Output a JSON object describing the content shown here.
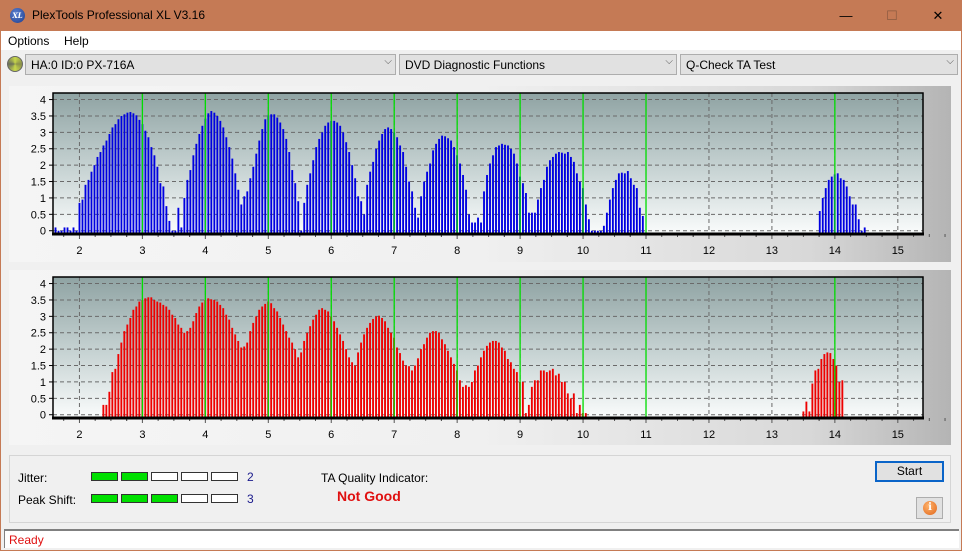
{
  "window": {
    "title": "PlexTools Professional XL V3.16",
    "app_icon_text": "XL",
    "controls": {
      "minimize": "—",
      "maximize": "☐",
      "close": "✕"
    }
  },
  "menu": {
    "items": [
      {
        "label": "Options"
      },
      {
        "label": "Help"
      }
    ]
  },
  "toolbar": {
    "drive": {
      "value": "HA:0 ID:0  PX-716A",
      "icon": "disc-drive-icon"
    },
    "function": {
      "value": "DVD Diagnostic Functions"
    },
    "test": {
      "value": "Q-Check TA Test"
    },
    "arrow": "⌵"
  },
  "colors": {
    "top_bars": "#0000e0",
    "bottom_bars": "#ee0000",
    "marker_lines": "#00dd00",
    "quality_text": "#e01010",
    "meter_on": "#00e000"
  },
  "chart_data": [
    {
      "type": "bar",
      "title": "",
      "name": "TA distribution (upper)",
      "xlabel": "",
      "ylabel": "",
      "xlim": [
        1.58,
        15.4
      ],
      "ylim": [
        -0.1,
        4.2
      ],
      "xticks": [
        2,
        3,
        4,
        5,
        6,
        7,
        8,
        9,
        10,
        11,
        12,
        13,
        14,
        15
      ],
      "yticks": [
        "0",
        "0.5",
        "1",
        "1.5",
        "2",
        "2.5",
        "3",
        "3.5",
        "4"
      ],
      "grid": true,
      "marker_lines": [
        3,
        4,
        5,
        6,
        7,
        8,
        9,
        10,
        11,
        14
      ],
      "bar_step": 0.0476,
      "segments": [
        {
          "start": 1.62,
          "values": [
            0.1,
            0,
            0,
            0.1,
            0.1,
            0,
            0.1,
            0,
            0.85,
            0.95,
            1.4,
            1.55,
            1.8,
            2.0,
            2.25,
            2.4,
            2.6,
            2.75,
            2.95,
            3.15,
            3.25,
            3.4,
            3.5,
            3.55,
            3.6,
            3.62,
            3.58,
            3.52,
            3.38,
            3.25,
            3.05,
            2.85,
            2.55,
            2.3,
            1.95,
            1.45,
            1.35,
            0.75,
            0.3,
            0,
            0,
            0.7,
            0.1,
            1.0,
            1.55,
            1.85,
            2.3,
            2.65,
            2.95,
            3.2,
            3.42,
            3.58,
            3.65,
            3.6,
            3.5,
            3.35,
            3.15,
            2.85,
            2.55,
            2.2,
            1.75,
            1.25,
            0.8,
            1.05,
            1.2,
            1.6,
            1.95,
            2.35,
            2.75,
            3.1,
            3.4,
            3.52,
            3.55,
            3.55,
            3.45,
            3.3,
            3.1,
            2.8,
            2.4,
            1.85,
            1.45,
            0.9,
            0,
            0.85,
            1.4,
            1.75,
            2.15,
            2.55,
            2.8,
            3.0,
            3.2,
            3.3,
            3.35,
            3.35,
            3.3,
            3.2,
            3.0,
            2.7,
            2.4,
            2.0,
            1.6,
            1.05,
            0.9,
            0.5,
            1.4,
            1.8,
            2.1,
            2.5,
            2.75,
            2.95,
            3.1,
            3.15,
            3.1,
            3.0,
            2.85,
            2.6,
            2.4,
            1.95,
            1.5,
            1.2,
            0.7,
            0.4,
            1.05,
            1.5,
            1.8,
            2.05,
            2.45,
            2.65,
            2.8,
            2.9,
            2.88,
            2.82,
            2.75,
            2.55,
            2.3,
            2.05,
            1.7,
            1.25,
            0.5,
            0.25,
            0.25,
            0.4,
            0.25,
            1.2,
            1.7,
            2.05,
            2.3,
            2.55,
            2.6,
            2.65,
            2.62,
            2.6,
            2.5,
            2.35,
            2.05,
            1.65,
            1.45,
            1.15,
            0.55,
            0.55,
            0.55,
            0.95,
            1.3,
            1.55,
            1.95,
            2.15,
            2.25,
            2.35,
            2.4,
            2.38,
            2.35,
            2.4,
            2.25,
            2.1,
            1.75,
            1.5,
            1.3,
            0.8,
            0.35,
            0,
            0,
            0,
            0,
            0.15,
            0.55,
            0.95,
            1.3,
            1.55,
            1.75,
            1.77,
            1.75,
            1.82,
            1.6,
            1.4,
            1.3,
            0.7,
            0.45
          ]
        },
        {
          "start": 13.76,
          "values": [
            0.6,
            1.0,
            1.3,
            1.55,
            1.65,
            1.72,
            1.75,
            1.6,
            1.55,
            1.35,
            1.05,
            0.8,
            0.8,
            0.35,
            0,
            0.1
          ]
        }
      ]
    },
    {
      "type": "bar",
      "title": "",
      "name": "TA distribution (lower)",
      "xlabel": "",
      "ylabel": "",
      "xlim": [
        1.58,
        15.4
      ],
      "ylim": [
        -0.1,
        4.2
      ],
      "xticks": [
        2,
        3,
        4,
        5,
        6,
        7,
        8,
        9,
        10,
        11,
        12,
        13,
        14,
        15
      ],
      "yticks": [
        "0",
        "0.5",
        "1",
        "1.5",
        "2",
        "2.5",
        "3",
        "3.5",
        "4"
      ],
      "grid": true,
      "marker_lines": [
        3,
        4,
        5,
        6,
        7,
        8,
        9,
        10,
        11,
        14
      ],
      "bar_step": 0.0476,
      "segments": [
        {
          "start": 2.38,
          "values": [
            0.3,
            0.3,
            0.7,
            1.3,
            1.4,
            1.85,
            2.2,
            2.55,
            2.75,
            2.95,
            3.2,
            3.3,
            3.45,
            3.5,
            3.55,
            3.58,
            3.58,
            3.5,
            3.45,
            3.42,
            3.35,
            3.3,
            3.2,
            3.05,
            2.95,
            2.75,
            2.65,
            2.5,
            2.55,
            2.65,
            2.85,
            3.1,
            3.3,
            3.42,
            3.5,
            3.55,
            3.52,
            3.5,
            3.45,
            3.35,
            3.25,
            3.05,
            2.9,
            2.65,
            2.45,
            2.25,
            2.05,
            2.08,
            2.2,
            2.55,
            2.8,
            3.0,
            3.2,
            3.3,
            3.38,
            3.45,
            3.4,
            3.25,
            3.15,
            2.95,
            2.75,
            2.55,
            2.35,
            2.2,
            2.0,
            1.75,
            1.9,
            2.25,
            2.5,
            2.7,
            2.9,
            3.05,
            3.2,
            3.25,
            3.2,
            3.15,
            3.0,
            2.85,
            2.65,
            2.45,
            2.25,
            2.0,
            1.75,
            1.6,
            1.5,
            1.9,
            2.2,
            2.45,
            2.65,
            2.8,
            2.92,
            3.0,
            3.02,
            2.95,
            2.85,
            2.65,
            2.5,
            2.35,
            2.05,
            1.88,
            1.65,
            1.5,
            1.48,
            1.35,
            1.5,
            1.72,
            2.0,
            2.15,
            2.35,
            2.5,
            2.55,
            2.55,
            2.5,
            2.3,
            2.15,
            1.95,
            1.75,
            1.55,
            1.35,
            1.05,
            0.85,
            0.9,
            0.85,
            1.0,
            1.35,
            1.5,
            1.75,
            1.95,
            2.1,
            2.2,
            2.25,
            2.25,
            2.2,
            2.05,
            1.95,
            1.7,
            1.6,
            1.4,
            1.3,
            1.0,
            1.0,
            0.05,
            0.3,
            0.85,
            1.05,
            1.05,
            1.35,
            1.35,
            1.3,
            1.35,
            1.4,
            1.2,
            1.25,
            1.0,
            1.0,
            0.65,
            0.5,
            0.65,
            0.05,
            0.3,
            0.05,
            0.05
          ]
        },
        {
          "start": 13.5,
          "values": [
            0.1,
            0.4,
            0.1,
            0.95,
            1.35,
            1.4,
            1.7,
            1.85,
            1.9,
            1.88,
            1.7,
            1.5,
            1.0,
            1.05
          ]
        }
      ]
    }
  ],
  "results": {
    "jitter": {
      "label": "Jitter:",
      "value": "2",
      "level": 2,
      "max": 5
    },
    "peak_shift": {
      "label": "Peak Shift:",
      "value": "3",
      "level": 3,
      "max": 5
    },
    "ta_quality": {
      "label": "TA Quality Indicator:",
      "value": "Not Good"
    }
  },
  "buttons": {
    "start": "Start",
    "info_icon": "info-icon"
  },
  "status": {
    "text": "Ready"
  }
}
